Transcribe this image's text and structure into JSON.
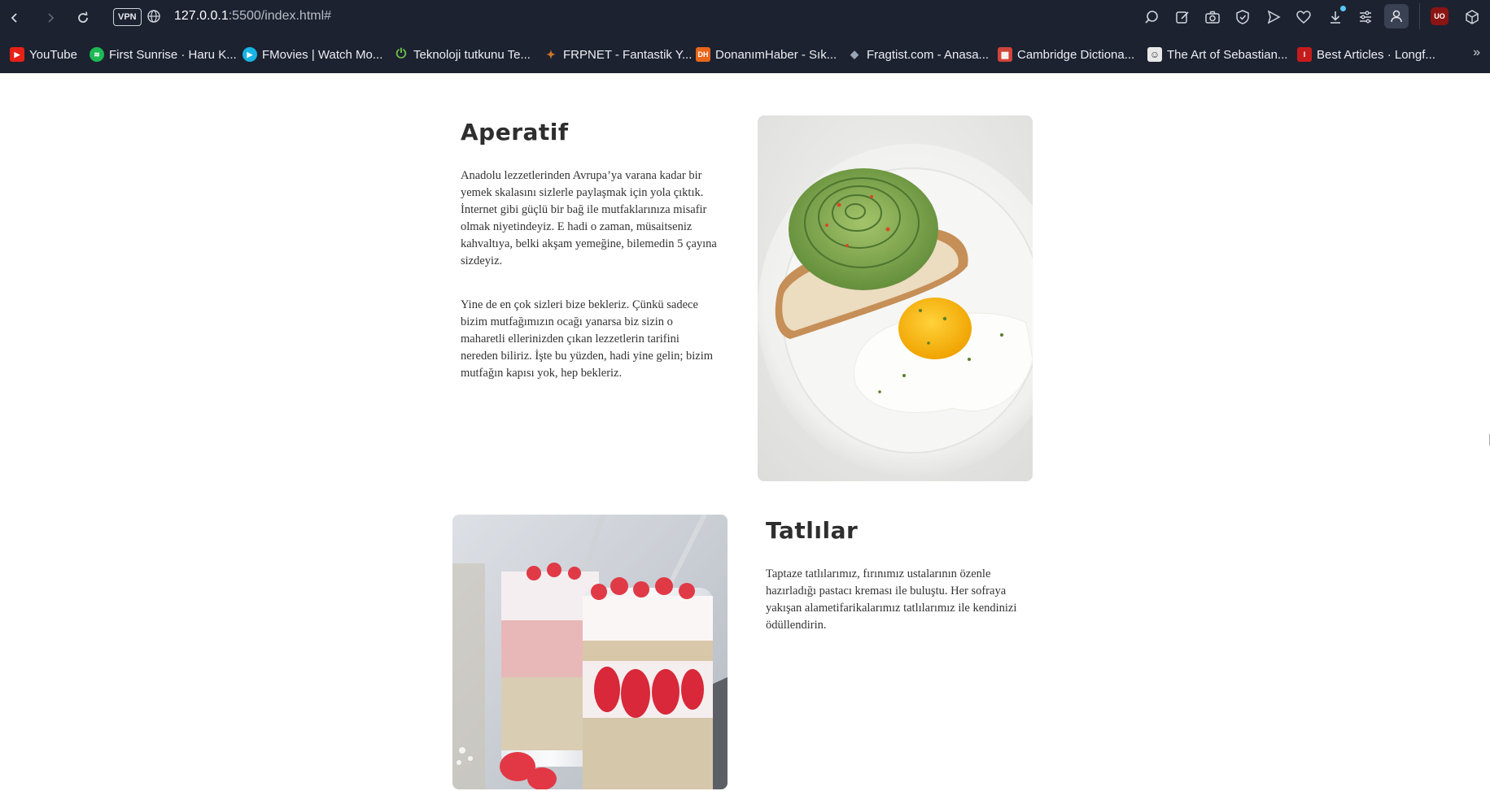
{
  "browser": {
    "vpn_label": "VPN",
    "url_host": "127.0.0.1",
    "url_rest": ":5500/index.html#",
    "icons": [
      "back-icon",
      "forward-icon",
      "reload-icon",
      "globe-icon",
      "search-icon",
      "snapshot-edit-icon",
      "camera-icon",
      "shield-icon",
      "send-icon",
      "heart-icon",
      "download-icon",
      "easy-setup-icon",
      "profile-icon",
      "ublock-icon",
      "extensions-cube-icon"
    ],
    "ublock_label": "UO"
  },
  "bookmarks": [
    {
      "label": "YouTube",
      "color": "#e62117",
      "glyph": "▶"
    },
    {
      "label": "First Sunrise · Haru K...",
      "color": "#1db954",
      "glyph": "≋"
    },
    {
      "label": "FMovies | Watch Mo...",
      "color": "#18b4e6",
      "glyph": "▶"
    },
    {
      "label": "Teknoloji tutkunu Te...",
      "color": "#6cc04a",
      "glyph": "⏻"
    },
    {
      "label": "FRPNET - Fantastik Y...",
      "color": "#c8742a",
      "glyph": "✦"
    },
    {
      "label": "DonanımHaber - Sık...",
      "color": "#e8661a",
      "glyph": "DH"
    },
    {
      "label": "Fragtist.com - Anasa...",
      "color": "#4b5b73",
      "glyph": "◆"
    },
    {
      "label": "Cambridge Dictiona...",
      "color": "#d0443a",
      "glyph": "▦"
    },
    {
      "label": "The Art of Sebastian...",
      "color": "#e8e8e8",
      "glyph": "☺"
    },
    {
      "label": "Best Articles · Longf...",
      "color": "#c41c1c",
      "glyph": "Ɩ"
    }
  ],
  "bookmarks_more": "»",
  "sections": {
    "aperatif": {
      "title": "Aperatif",
      "p1": "Anadolu lezzetlerinden Avrupa’ya varana kadar bir yemek skalasını sizlerle paylaşmak için yola çıktık. İnternet gibi güçlü bir bağ ile mutfaklarınıza misafir olmak niyetindeyiz. E hadi o zaman, müsaitseniz kahvaltıya, belki akşam yemeğine, bilemedin 5 çayına sizdeyiz.",
      "p2": "Yine de en çok sizleri bize bekleriz. Çünkü sadece bizim mutfağımızın ocağı yanarsa biz sizin o maharetli ellerinizden çıkan lezzetlerin tarifini nereden biliriz. İşte bu yüzden, hadi yine gelin; bizim mutfağın kapısı yok, hep bekleriz."
    },
    "tatlilar": {
      "title": "Tatlılar",
      "p1": "Taptaze tatlılarımız, fırınımız ustalarının özenle hazırladığı pastacı kreması ile buluştu. Her sofraya yakışan alametifarikalarımız tatlılarımız ile kendinizi ödüllendirin."
    }
  }
}
